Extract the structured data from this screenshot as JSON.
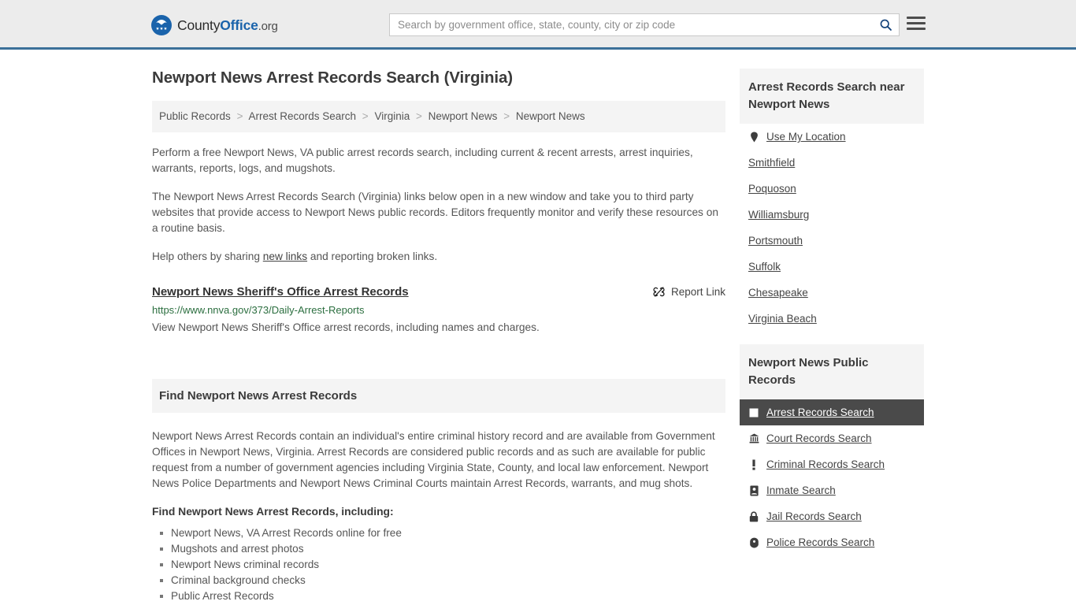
{
  "header": {
    "logo": {
      "text_1": "County",
      "text_2": "Office",
      "text_3": ".org",
      "icon": "eagle-seal-icon"
    },
    "search": {
      "placeholder": "Search by government office, state, county, city or zip code",
      "value": "",
      "icon": "search-icon"
    },
    "menu_icon": "hamburger-menu-icon",
    "accent_color": "#3b7099",
    "background": "#ececec"
  },
  "main": {
    "title": "Newport News Arrest Records Search (Virginia)",
    "breadcrumb": [
      "Public Records",
      "Arrest Records Search",
      "Virginia",
      "Newport News",
      "Newport News"
    ],
    "breadcrumb_separator": ">",
    "paragraphs": [
      "Perform a free Newport News, VA public arrest records search, including current & recent arrests, arrest inquiries, warrants, reports, logs, and mugshots.",
      "The Newport News Arrest Records Search (Virginia) links below open in a new window and take you to third party websites that provide access to Newport News public records. Editors frequently monitor and verify these resources on a routine basis."
    ],
    "help_text_before": "Help others by sharing ",
    "help_link": "new links",
    "help_text_after": " and reporting broken links.",
    "result": {
      "title": "Newport News Sheriff's Office Arrest Records",
      "url": "https://www.nnva.gov/373/Daily-Arrest-Reports",
      "description": "View Newport News Sheriff's Office arrest records, including names and charges.",
      "report_label": "Report Link",
      "report_icon": "broken-link-icon",
      "url_color": "#2b6e3f"
    },
    "section": {
      "heading": "Find Newport News Arrest Records",
      "body": "Newport News Arrest Records contain an individual's entire criminal history record and are available from Government Offices in Newport News, Virginia. Arrest Records are considered public records and as such are available for public request from a number of government agencies including Virginia State, County, and local law enforcement. Newport News Police Departments and Newport News Criminal Courts maintain Arrest Records, warrants, and mug shots.",
      "subheading": "Find Newport News Arrest Records, including:",
      "bullets": [
        "Newport News, VA Arrest Records online for free",
        "Mugshots and arrest photos",
        "Newport News criminal records",
        "Criminal background checks",
        "Public Arrest Records"
      ]
    }
  },
  "sidebar": {
    "nearby": {
      "heading": "Arrest Records Search near Newport News",
      "items": [
        {
          "label": "Use My Location",
          "icon": "map-pin-icon"
        },
        {
          "label": "Smithfield",
          "icon": ""
        },
        {
          "label": "Poquoson",
          "icon": ""
        },
        {
          "label": "Williamsburg",
          "icon": ""
        },
        {
          "label": "Portsmouth",
          "icon": ""
        },
        {
          "label": "Suffolk",
          "icon": ""
        },
        {
          "label": "Chesapeake",
          "icon": ""
        },
        {
          "label": "Virginia Beach",
          "icon": ""
        }
      ]
    },
    "public_records": {
      "heading": "Newport News Public Records",
      "active_index": 0,
      "active_color": "#4a4a4a",
      "items": [
        {
          "label": "Arrest Records Search",
          "icon": "square-icon"
        },
        {
          "label": "Court Records Search",
          "icon": "courthouse-icon"
        },
        {
          "label": "Criminal Records Search",
          "icon": "exclamation-icon"
        },
        {
          "label": "Inmate Search",
          "icon": "id-badge-icon"
        },
        {
          "label": "Jail Records Search",
          "icon": "lock-icon"
        },
        {
          "label": "Police Records Search",
          "icon": "police-badge-icon"
        }
      ]
    }
  }
}
